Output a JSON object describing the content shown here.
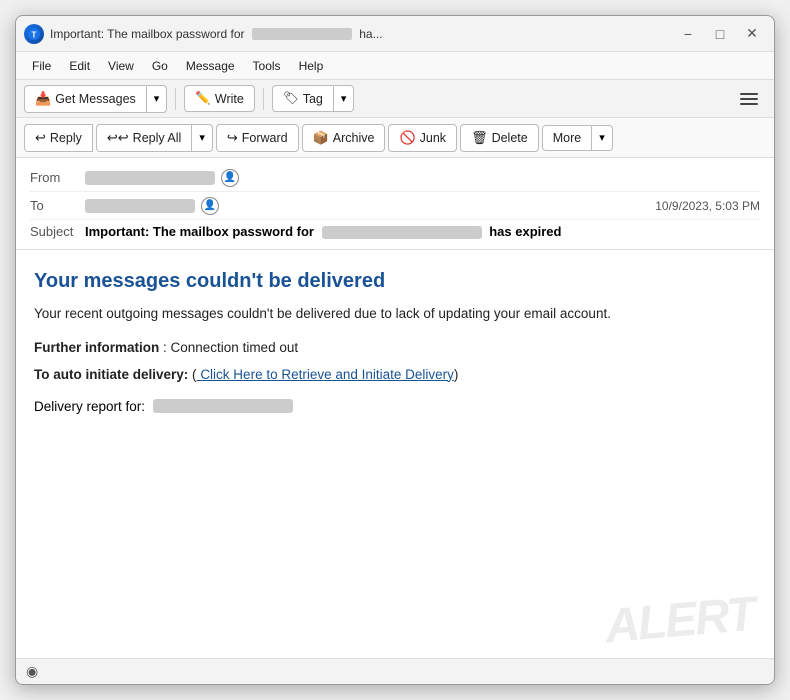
{
  "window": {
    "title": "Important: The mailbox password for",
    "title_suffix": "ha...",
    "icon_label": "T"
  },
  "menu": {
    "items": [
      "File",
      "Edit",
      "View",
      "Go",
      "Message",
      "Tools",
      "Help"
    ]
  },
  "toolbar": {
    "get_messages_label": "Get Messages",
    "write_label": "Write",
    "tag_label": "Tag"
  },
  "actions": {
    "reply_label": "Reply",
    "reply_all_label": "Reply All",
    "forward_label": "Forward",
    "archive_label": "Archive",
    "junk_label": "Junk",
    "delete_label": "Delete",
    "more_label": "More"
  },
  "email_header": {
    "from_label": "From",
    "from_value_width": 130,
    "to_label": "To",
    "to_value_width": 110,
    "timestamp": "10/9/2023, 5:03 PM",
    "subject_label": "Subject",
    "subject_text": "Important: The mailbox password for",
    "subject_redacted_width": 160,
    "subject_suffix": "has expired"
  },
  "email_body": {
    "heading": "Your messages couldn't be delivered",
    "paragraph1": "Your recent outgoing messages couldn't be delivered due to lack of updating your email account.",
    "further_label": "Further information",
    "further_value": ": Connection timed out",
    "auto_label": "To auto initiate delivery:",
    "auto_link_prefix": " (",
    "auto_link_text": "Click Here to Retrieve and Initiate Delivery",
    "auto_link_suffix": ")",
    "delivery_label": "Delivery report for:",
    "delivery_redacted_width": 140,
    "watermark": "ALERT"
  },
  "status_bar": {
    "icon": "◉"
  }
}
